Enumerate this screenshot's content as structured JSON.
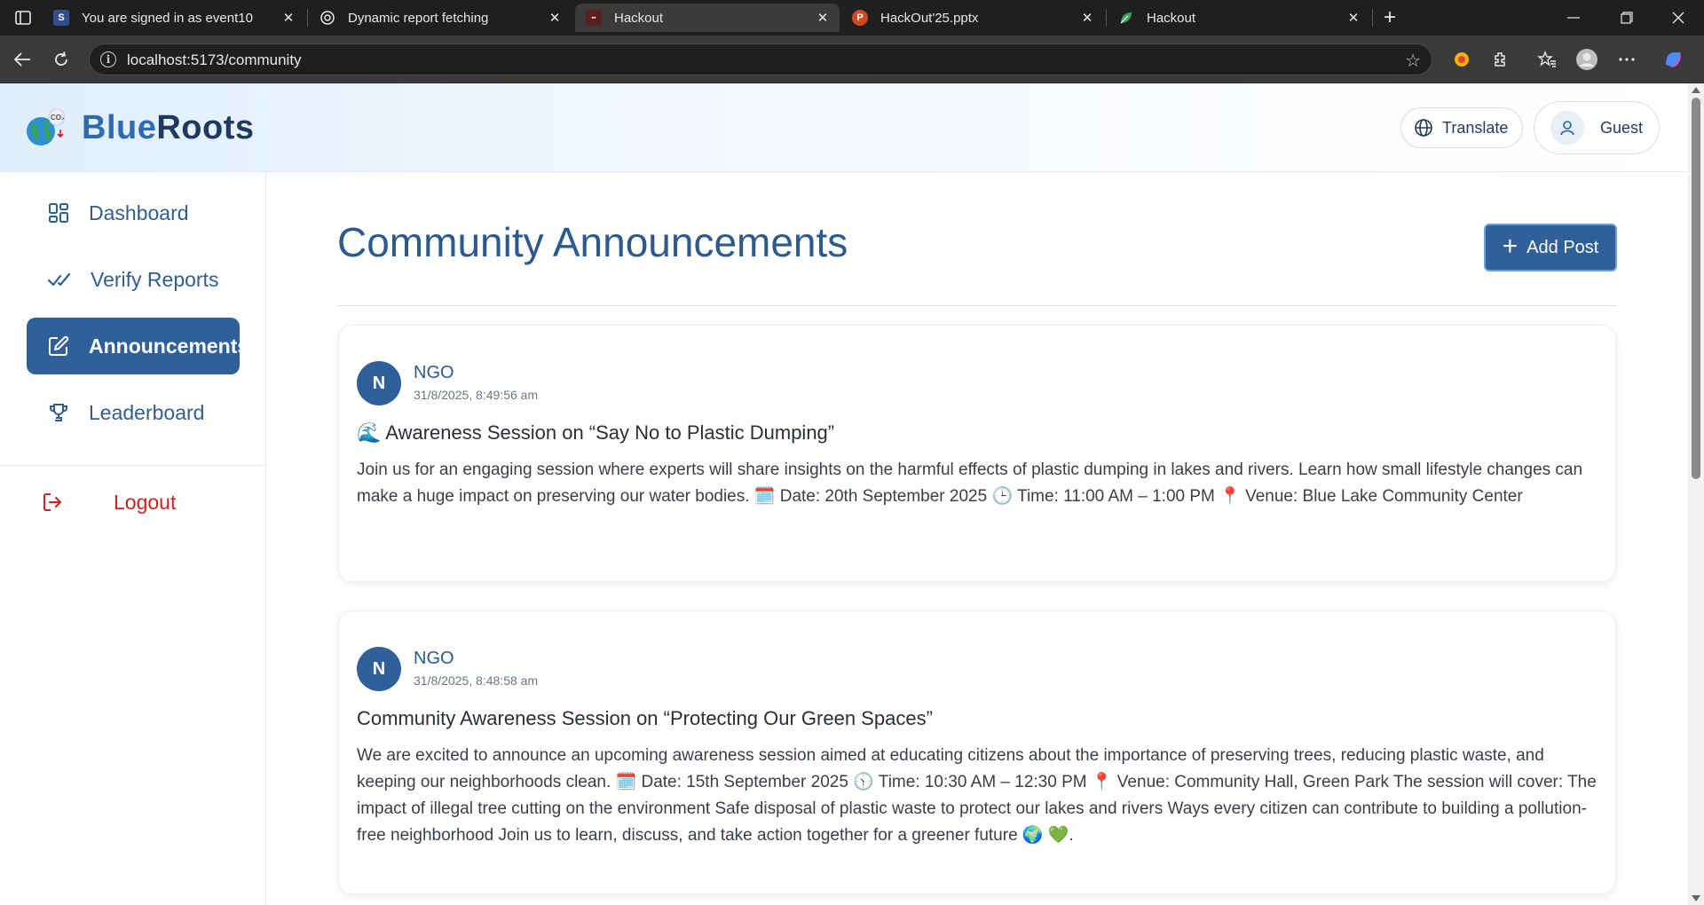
{
  "browser": {
    "tabs": [
      {
        "title": "You are signed in as event10",
        "favicon": "S"
      },
      {
        "title": "Dynamic report fetching",
        "favicon": "openai-icon"
      },
      {
        "title": "Hackout",
        "favicon": "app-icon"
      },
      {
        "title": "HackOut'25.pptx",
        "favicon": "powerpoint-icon"
      },
      {
        "title": "Hackout",
        "favicon": "leaf-icon"
      }
    ],
    "url": "localhost:5173/community"
  },
  "header": {
    "brand_blue": "Blue",
    "brand_roots": "Roots",
    "logo_badge": "CO₂",
    "translate_label": "Translate",
    "user_label": "Guest"
  },
  "sidebar": {
    "items": [
      {
        "label": "Dashboard",
        "icon": "dashboard-icon"
      },
      {
        "label": "Verify Reports",
        "icon": "double-check-icon"
      },
      {
        "label": "Announcements",
        "icon": "edit-icon"
      },
      {
        "label": "Leaderboard",
        "icon": "trophy-icon"
      }
    ],
    "logout_label": "Logout"
  },
  "main": {
    "title": "Community Announcements",
    "add_post_label": "Add Post",
    "posts": [
      {
        "avatar": "N",
        "author": "NGO",
        "time": "31/8/2025, 8:49:56 am",
        "title": "🌊 Awareness Session on “Say No to Plastic Dumping”",
        "body": "Join us for an engaging session where experts will share insights on the harmful effects of plastic dumping in lakes and rivers. Learn how small lifestyle changes can make a huge impact on preserving our water bodies. 🗓️ Date: 20th September 2025 🕒 Time: 11:00 AM – 1:00 PM 📍 Venue: Blue Lake Community Center"
      },
      {
        "avatar": "N",
        "author": "NGO",
        "time": "31/8/2025, 8:48:58 am",
        "title": "Community Awareness Session on “Protecting Our Green Spaces”",
        "body": "We are excited to announce an upcoming awareness session aimed at educating citizens about the importance of preserving trees, reducing plastic waste, and keeping our neighborhoods clean. 🗓️ Date: 15th September 2025 🕥 Time: 10:30 AM – 12:30 PM 📍 Venue: Community Hall, Green Park The session will cover: The impact of illegal tree cutting on the environment Safe disposal of plastic waste to protect our lakes and rivers Ways every citizen can contribute to building a pollution-free neighborhood Join us to learn, discuss, and take action together for a greener future 🌍 💚."
      }
    ]
  },
  "colors": {
    "primary": "#2f6099",
    "heading": "#2c5a8c",
    "logout": "#d11f1f"
  }
}
